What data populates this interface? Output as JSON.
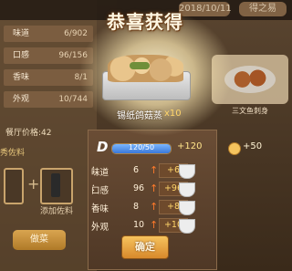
{
  "topbar": {
    "tabs": [
      "2018/10/11",
      "得之易"
    ]
  },
  "left_panel": {
    "stats": [
      {
        "label": "味道",
        "value": "6/902"
      },
      {
        "label": "口感",
        "value": "96/156"
      },
      {
        "label": "香味",
        "value": "8/1"
      },
      {
        "label": "外观",
        "value": "10/744"
      }
    ],
    "price": "餐厅价格:42",
    "side_label": "秀佐料",
    "add_label": "添加佐料",
    "button_label": "做菜"
  },
  "right_panel": {
    "card_label": "三文鱼刺身"
  },
  "modal": {
    "title": "恭喜获得",
    "dish_name": "锡纸鸽菇蒸",
    "dish_count": "x10",
    "exp": {
      "current": 120,
      "max": 50,
      "text": "120/50",
      "gain": "+120"
    },
    "coin_gain": "+50",
    "attributes": [
      {
        "name": "味道",
        "value": "6",
        "delta": "+6"
      },
      {
        "name": "口感",
        "value": "96",
        "delta": "+96"
      },
      {
        "name": "香味",
        "value": "8",
        "delta": "+8"
      },
      {
        "name": "外观",
        "value": "10",
        "delta": "+10"
      }
    ],
    "confirm_label": "确定"
  }
}
